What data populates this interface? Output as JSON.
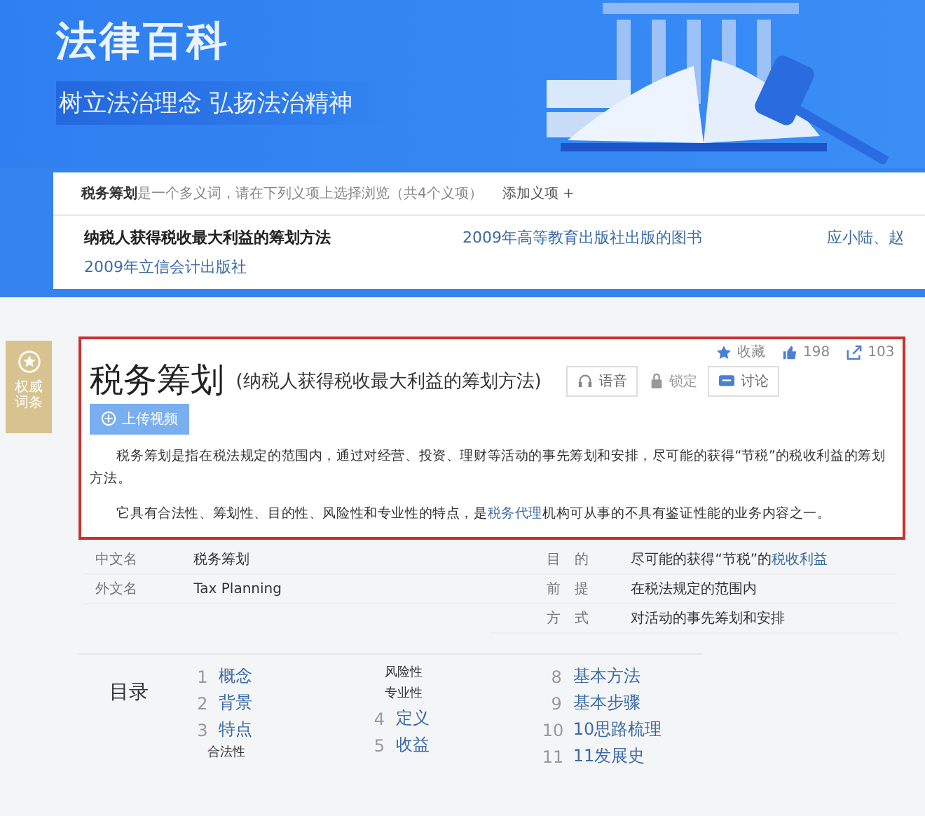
{
  "banner": {
    "title": "法律百科",
    "slogan": "树立法治理念  弘扬法治精神"
  },
  "disambiguation": {
    "intro": "**税务筹划**是一个多义词，请在下列义项上选择浏览（共4个义项）",
    "add_label": "添加义项 +",
    "senses": [
      {
        "label": "纳税人获得税收最大利益的筹划方法",
        "selected": true
      },
      {
        "label": "2009年高等教育出版社出版的图书",
        "selected": false
      },
      {
        "label": "应小陆、赵",
        "selected": false
      },
      {
        "label": "2009年立信会计出版社",
        "selected": false
      }
    ]
  },
  "badge": {
    "label": "权威词条"
  },
  "entry": {
    "actions": [
      {
        "kind": "star",
        "label": "收藏"
      },
      {
        "kind": "like",
        "label": "198"
      },
      {
        "kind": "share",
        "label": "103"
      }
    ],
    "title": "税务筹划",
    "subtitle": "(纳税人获得税收最大利益的筹划方法)",
    "tools": [
      {
        "kind": "audio",
        "label": "语音"
      },
      {
        "kind": "lock",
        "label": "锁定"
      },
      {
        "kind": "discuss",
        "label": "讨论"
      }
    ],
    "upload_label": "上传视频",
    "paragraphs": [
      [
        {
          "text": "税务筹划是指在税法规定的范围内，通过对经营、投资、理财等活动的事先筹划和安排，尽可能的获得“节税”的税收利益的筹划方法。",
          "link": false
        }
      ],
      [
        {
          "text": "它具有合法性、筹划性、目的性、风险性和专业性的特点，是",
          "link": false
        },
        {
          "text": "税务代理",
          "link": true
        },
        {
          "text": "机构可从事的不具有鉴证性能的业务内容之一。",
          "link": false
        }
      ]
    ]
  },
  "infobox": {
    "left": [
      {
        "label": "中文名",
        "value": [
          {
            "text": "税务筹划",
            "link": false
          }
        ]
      },
      {
        "label": "外文名",
        "value": [
          {
            "text": "Tax Planning",
            "link": false
          }
        ]
      }
    ],
    "right": [
      {
        "label": "目　的",
        "value": [
          {
            "text": "尽可能的获得“节税”的",
            "link": false
          },
          {
            "text": "税收利益",
            "link": true
          }
        ]
      },
      {
        "label": "前　提",
        "value": [
          {
            "text": "在税法规定的范围内",
            "link": false
          }
        ]
      },
      {
        "label": "方　式",
        "value": [
          {
            "text": "对活动的事先筹划和安排",
            "link": false
          }
        ]
      }
    ]
  },
  "toc": {
    "title": "目录",
    "columns": [
      [
        {
          "kind": "main",
          "number": "1",
          "label": "概念"
        },
        {
          "kind": "main",
          "number": "2",
          "label": "背景"
        },
        {
          "kind": "main",
          "number": "3",
          "label": "特点"
        },
        {
          "kind": "sub",
          "label": "合法性"
        }
      ],
      [
        {
          "kind": "sub",
          "label": "风险性"
        },
        {
          "kind": "sub",
          "label": "专业性"
        },
        {
          "kind": "main",
          "number": "4",
          "label": "定义"
        },
        {
          "kind": "main",
          "number": "5",
          "label": "收益"
        }
      ],
      [
        {
          "kind": "main",
          "number": "8",
          "label": "基本方法"
        },
        {
          "kind": "main",
          "number": "9",
          "label": "基本步骤"
        },
        {
          "kind": "main",
          "number": "10",
          "label": "10思路梳理"
        },
        {
          "kind": "main",
          "number": "11",
          "label": "11发展史"
        }
      ]
    ]
  }
}
